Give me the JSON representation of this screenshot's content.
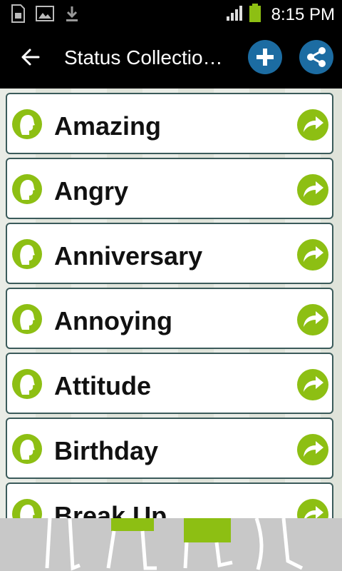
{
  "status_bar": {
    "time": "8:15 PM",
    "icons": [
      "sim-card-icon",
      "image-icon",
      "download-icon",
      "signal-icon",
      "battery-icon"
    ]
  },
  "action_bar": {
    "title": "Status Collectio…",
    "back_icon": "arrow-left-icon",
    "add_icon": "plus-icon",
    "share_icon": "share-icon"
  },
  "list": {
    "items": [
      {
        "label": "Amazing"
      },
      {
        "label": "Angry"
      },
      {
        "label": "Anniversary"
      },
      {
        "label": "Annoying"
      },
      {
        "label": "Attitude"
      },
      {
        "label": "Birthday"
      },
      {
        "label": "Break Up"
      }
    ],
    "lead_icon": "face-profile-icon",
    "trail_icon": "forward-arrow-icon"
  },
  "colors": {
    "accent_green": "#8dbf13",
    "button_blue": "#1c6ca2",
    "card_border": "#3b5b5b"
  }
}
